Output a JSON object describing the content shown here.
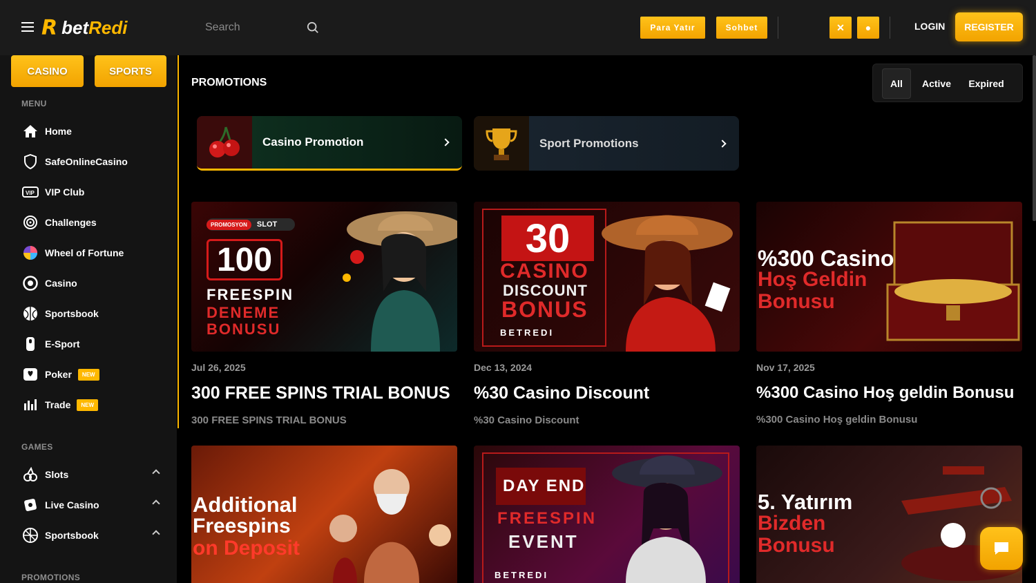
{
  "header": {
    "logo_bet": "bet",
    "logo_redi": "Redi",
    "search_placeholder": "Search",
    "deposit_label": "Para Yatır",
    "chat_label": "Sohbet",
    "login_label": "LOGIN",
    "register_label": "REGISTER"
  },
  "sidebar": {
    "casino_tab": "CASINO",
    "sports_tab": "SPORTS",
    "menu_title": "MENU",
    "menu_items": [
      {
        "label": "Home",
        "icon": "home-icon"
      },
      {
        "label": "SafeOnlineCasino",
        "icon": "shield-icon"
      },
      {
        "label": "VIP Club",
        "icon": "vip-icon"
      },
      {
        "label": "Challenges",
        "icon": "target-icon"
      },
      {
        "label": "Wheel of Fortune",
        "icon": "wheel-icon"
      },
      {
        "label": "Casino",
        "icon": "chip-icon"
      },
      {
        "label": "Sportsbook",
        "icon": "ball-icon"
      },
      {
        "label": "E-Sport",
        "icon": "gamepad-icon"
      },
      {
        "label": "Poker",
        "icon": "cards-icon",
        "badge": "NEW"
      },
      {
        "label": "Trade",
        "icon": "chart-icon",
        "badge": "NEW"
      }
    ],
    "games_title": "GAMES",
    "games_items": [
      {
        "label": "Slots",
        "icon": "slots-icon"
      },
      {
        "label": "Live Casino",
        "icon": "live-casino-icon"
      },
      {
        "label": "Sportsbook",
        "icon": "sportsbook-icon"
      }
    ],
    "promotions_title": "PROMOTIONS"
  },
  "main": {
    "title": "PROMOTIONS",
    "filters": [
      "All",
      "Active",
      "Expired"
    ],
    "categories": [
      {
        "label": "Casino Promotion"
      },
      {
        "label": "Sport Promotions"
      }
    ],
    "cards": [
      {
        "date": "Jul 26, 2025",
        "title": "300 FREE SPINS TRIAL BONUS",
        "subtitle": "300 FREE SPINS TRIAL BONUS",
        "img_tag1": "PROMOSYON",
        "img_tag2": "SLOT",
        "img_big": "100",
        "img_line1": "FREESPIN",
        "img_line2": "DENEME",
        "img_line3": "BONUSU"
      },
      {
        "date": "Dec 13, 2024",
        "title": "%30 Casino Discount",
        "subtitle": "%30 Casino Discount",
        "img_big": "30",
        "img_line1": "CASINO",
        "img_line2": "DISCOUNT",
        "img_line3": "BONUS",
        "img_brand": "BETREDI"
      },
      {
        "date": "Nov 17, 2025",
        "title": "%300 Casino Hoş geldin Bonusu",
        "subtitle": "%300 Casino Hoş geldin Bonusu",
        "img_line1": "%300 Casino",
        "img_line2": "Hoş Geldin",
        "img_line3": "Bonusu"
      },
      {
        "img_line1": "Additional",
        "img_line2": "Freespins",
        "img_line3": "on Deposit"
      },
      {
        "img_line1": "DAY END",
        "img_line2": "FREESPIN",
        "img_line3": "EVENT",
        "img_brand": "BETREDI"
      },
      {
        "img_line1": "5. Yatırım",
        "img_line2": "Bizden",
        "img_line3": "Bonusu"
      }
    ]
  },
  "colors": {
    "accent": "#ffb800",
    "bg": "#000000",
    "sidebar": "#141414",
    "topbar": "#1b1b1b"
  }
}
